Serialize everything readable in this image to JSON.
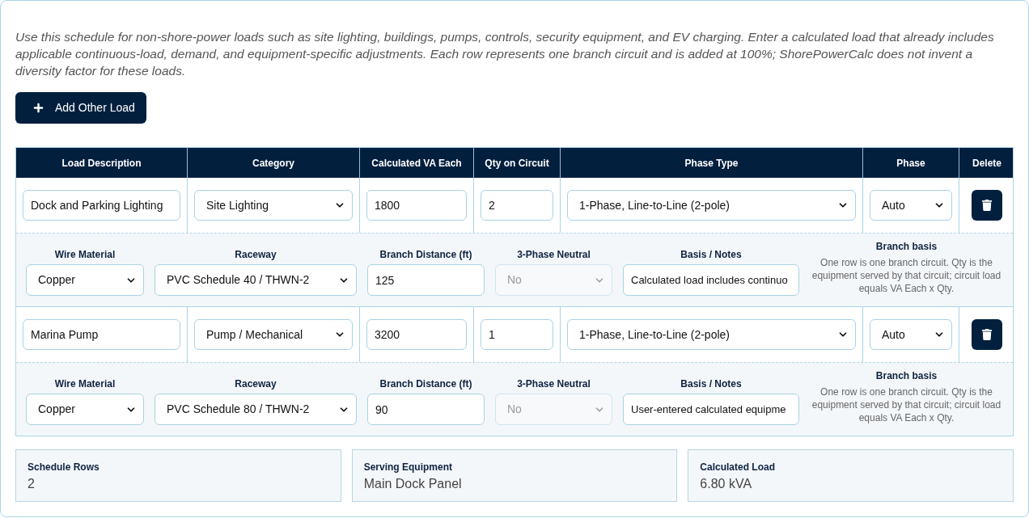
{
  "intro": "Use this schedule for non-shore-power loads such as site lighting, buildings, pumps, controls, security equipment, and EV charging. Enter a calculated load that already includes applicable continuous-load, demand, and equipment-specific adjustments. Each row represents one branch circuit and is added at 100%; ShorePowerCalc does not invent a diversity factor for these loads.",
  "add_button": {
    "label": "Add Other Load"
  },
  "table": {
    "columns": [
      "Load Description",
      "Category",
      "Calculated VA Each",
      "Qty on Circuit",
      "Phase Type",
      "Phase",
      "Delete"
    ],
    "rows": [
      {
        "cells": [
          {
            "kind": "input",
            "value": "Dock and Parking Lighting"
          },
          {
            "kind": "select",
            "value": "Site Lighting"
          },
          {
            "kind": "input",
            "value": "1800"
          },
          {
            "kind": "input",
            "value": "2"
          },
          {
            "kind": "select",
            "value": "1-Phase, Line-to-Line (2-pole)"
          },
          {
            "kind": "select",
            "value": "Auto"
          }
        ],
        "details": {
          "fields": [
            {
              "label": "Wire Material",
              "kind": "select",
              "value": "Copper",
              "disabled": false
            },
            {
              "label": "Raceway",
              "kind": "select",
              "value": "PVC Schedule 40 / THWN-2",
              "disabled": false
            },
            {
              "label": "Branch Distance (ft)",
              "kind": "input",
              "value": "125",
              "disabled": false
            },
            {
              "label": "3-Phase Neutral",
              "kind": "select",
              "value": "No",
              "disabled": true
            },
            {
              "label": "Basis / Notes",
              "kind": "input",
              "value": "Calculated load includes continuo",
              "disabled": false
            }
          ],
          "basis": {
            "title": "Branch basis",
            "text": "One row is one branch circuit. Qty is the equipment served by that circuit; circuit load equals VA Each x Qty."
          }
        }
      },
      {
        "cells": [
          {
            "kind": "input",
            "value": "Marina Pump"
          },
          {
            "kind": "select",
            "value": "Pump / Mechanical"
          },
          {
            "kind": "input",
            "value": "3200"
          },
          {
            "kind": "input",
            "value": "1"
          },
          {
            "kind": "select",
            "value": "1-Phase, Line-to-Line (2-pole)"
          },
          {
            "kind": "select",
            "value": "Auto"
          }
        ],
        "details": {
          "fields": [
            {
              "label": "Wire Material",
              "kind": "select",
              "value": "Copper",
              "disabled": false
            },
            {
              "label": "Raceway",
              "kind": "select",
              "value": "PVC Schedule 80 / THWN-2",
              "disabled": false
            },
            {
              "label": "Branch Distance (ft)",
              "kind": "input",
              "value": "90",
              "disabled": false
            },
            {
              "label": "3-Phase Neutral",
              "kind": "select",
              "value": "No",
              "disabled": true
            },
            {
              "label": "Basis / Notes",
              "kind": "input",
              "value": "User-entered calculated equipme",
              "disabled": false
            }
          ],
          "basis": {
            "title": "Branch basis",
            "text": "One row is one branch circuit. Qty is the equipment served by that circuit; circuit load equals VA Each x Qty."
          }
        }
      }
    ]
  },
  "summary": [
    {
      "label": "Schedule Rows",
      "value": "2"
    },
    {
      "label": "Serving Equipment",
      "value": "Main Dock Panel"
    },
    {
      "label": "Calculated Load",
      "value": "6.80 kVA"
    }
  ]
}
